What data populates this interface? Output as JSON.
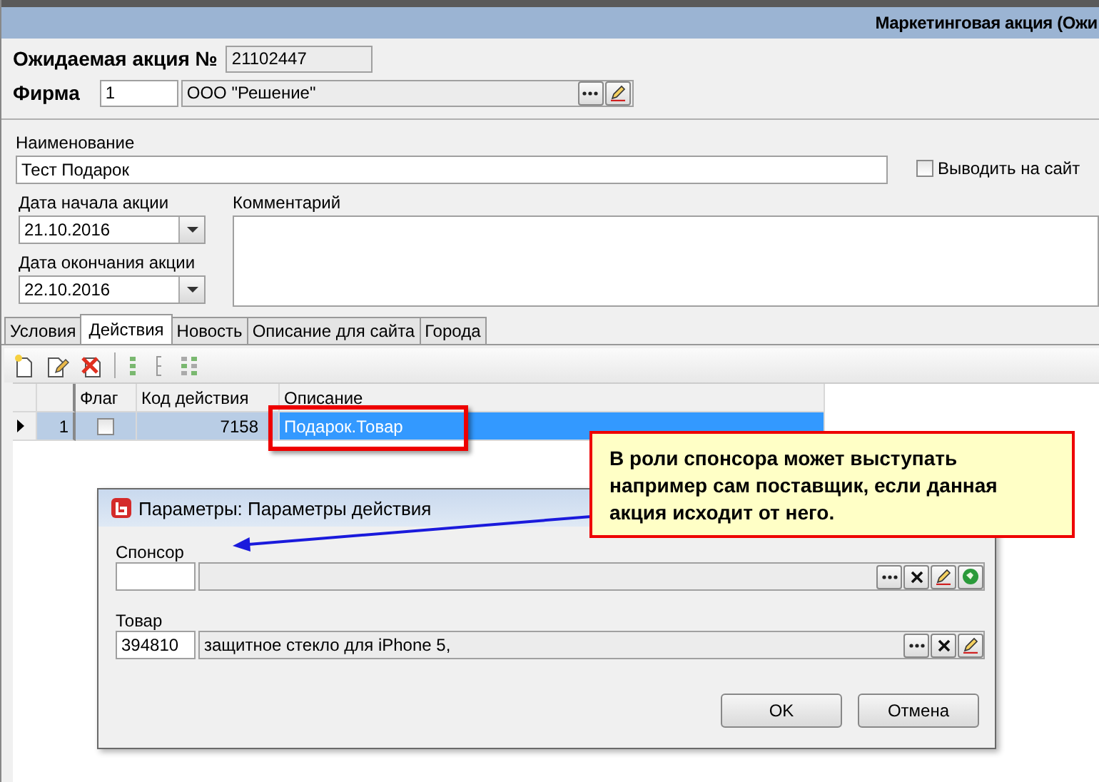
{
  "window": {
    "title": "Маркетинговая акция (Ожи"
  },
  "header": {
    "number_label": "Ожидаемая акция №",
    "number": "21102447",
    "firm_label": "Фирма",
    "firm_code": "1",
    "firm_name": "ООО \"Решение\""
  },
  "name": {
    "label": "Наименование",
    "value": "Тест Подарок"
  },
  "publish": {
    "label": "Выводить на сайт",
    "checked": false
  },
  "start_date": {
    "label": "Дата начала акции",
    "value": "21.10.2016"
  },
  "end_date": {
    "label": "Дата окончания акции",
    "value": "22.10.2016"
  },
  "comment": {
    "label": "Комментарий"
  },
  "tabs": [
    {
      "label": "Условия",
      "selected": false
    },
    {
      "label": "Действия",
      "selected": true
    },
    {
      "label": "Новость",
      "selected": false
    },
    {
      "label": "Описание для сайта",
      "selected": false
    },
    {
      "label": "Города",
      "selected": false
    }
  ],
  "grid": {
    "columns": [
      "Флаг",
      "Код действия",
      "Описание"
    ],
    "rows": [
      {
        "number": "1",
        "flag": false,
        "code": "7158",
        "description": "Подарок.Товар",
        "selected": true
      }
    ]
  },
  "callout": {
    "text": "В роли спонсора может выступать например сам поставщик, если данная акция исходит от него."
  },
  "dialog": {
    "title": "Параметры: Параметры действия",
    "fields": [
      {
        "label": "Спонсор",
        "buttons": [
          {
            "kind": "browse"
          },
          {
            "kind": "clear"
          },
          {
            "kind": "edit"
          },
          {
            "kind": "web"
          }
        ]
      },
      {
        "label": "Товар",
        "code": "394810",
        "value": "защитное стекло для iPhone 5,",
        "buttons": [
          {
            "kind": "browse"
          },
          {
            "kind": "clear"
          },
          {
            "kind": "edit"
          }
        ]
      }
    ],
    "buttons": [
      "OK",
      "Отмена"
    ]
  }
}
